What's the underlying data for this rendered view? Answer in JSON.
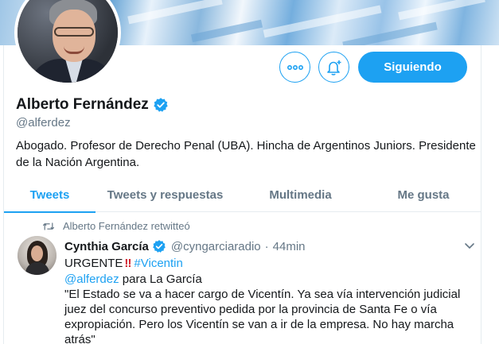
{
  "profile": {
    "display_name": "Alberto Fernández",
    "handle": "@alferdez",
    "bio": "Abogado. Profesor de Derecho Penal (UBA). Hincha de Argentinos Juniors. Presidente de la Nación Argentina.",
    "follow_button_label": "Siguiendo",
    "more_icon": "more-icon",
    "bell_icon": "notification-bell-icon",
    "verified_icon": "verified-badge-icon"
  },
  "tabs": [
    {
      "label": "Tweets",
      "active": true
    },
    {
      "label": "Tweets y respuestas",
      "active": false
    },
    {
      "label": "Multimedia",
      "active": false
    },
    {
      "label": "Me gusta",
      "active": false
    }
  ],
  "tweet": {
    "retweet_context": "Alberto Fernández retwitteó",
    "author_name": "Cynthia García",
    "author_handle": "@cyngarciaradio",
    "separator": "·",
    "time": "44min",
    "line1_text": "URGENTE",
    "line1_emoji": "‼",
    "line1_hashtag": "#Vicentin",
    "line2_mention": "@alferdez",
    "line2_text": " para La García",
    "line3": "\"El Estado se va a hacer cargo de Vicentín. Ya sea vía intervención judicial",
    "line4": "juez del concurso preventivo pedida por la provincia de Santa Fe o vía",
    "line5": "expropiación. Pero los Vicentín se van a ir de la empresa. No hay marcha",
    "line6": "atrás\""
  },
  "colors": {
    "accent": "#1da1f2",
    "text": "#14171a",
    "muted": "#657786",
    "divider": "#e6ecf0"
  }
}
